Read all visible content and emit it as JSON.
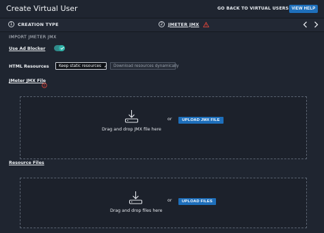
{
  "header": {
    "title": "Create Virtual User",
    "back_link": "GO BACK TO VIRTUAL USERS",
    "help_button": "VIEW HELP"
  },
  "steps": [
    {
      "number": "1",
      "label": "CREATION TYPE"
    },
    {
      "number": "2",
      "label": "JMETER JMX",
      "status": "warning"
    }
  ],
  "import": {
    "section_title": "IMPORT JMETER JMX",
    "ad_blocker_label": "Use Ad Blocker",
    "ad_blocker_on": true,
    "html_resources_label": "HTML Resources",
    "options": [
      {
        "label": "Keep static resources",
        "selected": true
      },
      {
        "label": "Download resources dynamically",
        "selected": false
      }
    ],
    "jmx_file_label": "JMeter JMX File",
    "jmx_drop_text": "Drag and drop JMX file here",
    "or": "or",
    "upload_jmx": "UPLOAD JMX FILE",
    "resource_files_label": "Resource Files",
    "files_drop_text": "Drag and drop files here",
    "upload_files": "UPLOAD FILES"
  },
  "colors": {
    "background": "#1f2530",
    "primary": "#1e6fbb",
    "toggle_on": "#2fb3a8",
    "warning": "#e0453a"
  }
}
